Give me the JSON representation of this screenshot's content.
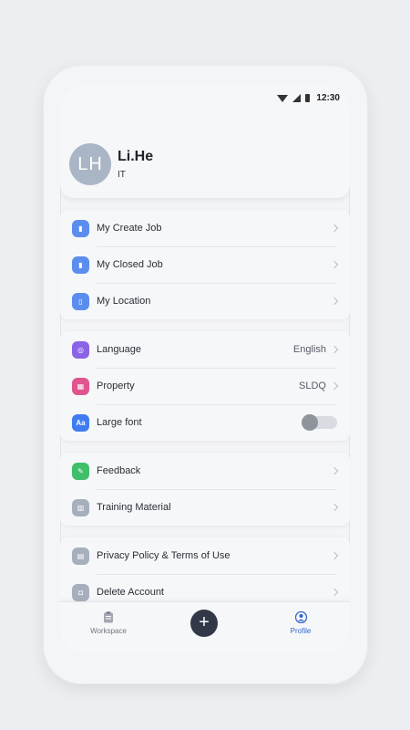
{
  "status_bar": {
    "time": "12:30"
  },
  "profile": {
    "initials": "LH",
    "name": "Li.He",
    "department": "IT"
  },
  "groups": [
    [
      {
        "label": "My Create Job",
        "icon": "create-job-icon",
        "color": "#5b8def",
        "value": "",
        "control": "chevron"
      },
      {
        "label": "My Closed Job",
        "icon": "closed-job-icon",
        "color": "#5b8def",
        "value": "",
        "control": "chevron"
      },
      {
        "label": "My Location",
        "icon": "location-icon",
        "color": "#5b8def",
        "value": "",
        "control": "chevron"
      }
    ],
    [
      {
        "label": "Language",
        "icon": "language-icon",
        "color": "#8a63e6",
        "value": "English",
        "control": "chevron"
      },
      {
        "label": "Property",
        "icon": "property-icon",
        "color": "#e0558f",
        "value": "SLDQ",
        "control": "chevron"
      },
      {
        "label": "Large font",
        "icon": "font-icon",
        "color": "#3f7cf0",
        "value": "",
        "control": "toggle",
        "toggle_on": false
      }
    ],
    [
      {
        "label": "Feedback",
        "icon": "feedback-icon",
        "color": "#3fbf6a",
        "value": "",
        "control": "chevron"
      },
      {
        "label": "Training Material",
        "icon": "training-material-icon",
        "color": "#a7afbd",
        "value": "",
        "control": "chevron"
      }
    ],
    [
      {
        "label": "Privacy Policy & Terms of Use",
        "icon": "privacy-policy-icon",
        "color": "#a7afbd",
        "value": "",
        "control": "chevron"
      },
      {
        "label": "Delete Account",
        "icon": "delete-account-icon",
        "color": "#a7afbd",
        "value": "",
        "control": "chevron"
      }
    ]
  ],
  "bottom_nav": {
    "workspace_label": "Workspace",
    "add_label": "+",
    "profile_label": "Profile",
    "active_tab": "Profile",
    "active_color": "#3366cc"
  },
  "colors": {
    "avatar_bg": "#aab6c6",
    "fab_bg": "#323847"
  }
}
